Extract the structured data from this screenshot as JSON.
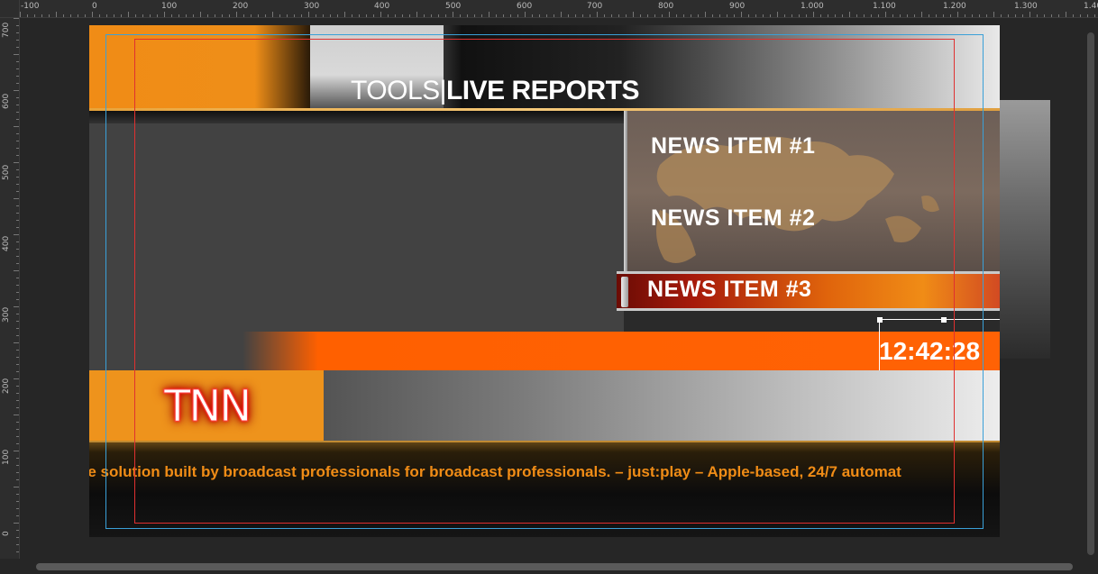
{
  "ruler": {
    "top_labels": [
      "-100",
      "0",
      "100",
      "200",
      "300",
      "400",
      "500",
      "600",
      "700",
      "800",
      "900",
      "1.000",
      "1.100",
      "1.200",
      "1.300",
      "1.40"
    ],
    "left_labels": [
      "700",
      "600",
      "500",
      "400",
      "300",
      "200",
      "100",
      "0"
    ]
  },
  "stage": {
    "header": {
      "title_left": "TOOLS|",
      "title_right": "LIVE REPORTS"
    },
    "news": {
      "item1": "NEWS ITEM #1",
      "item2": "NEWS ITEM #2",
      "item3": "NEWS ITEM #3"
    },
    "clock": "12:42:28",
    "logo": "TNN",
    "ticker": "ge solution built by broadcast professionals for broadcast professionals.  –  just:play – Apple-based, 24/7 automat"
  },
  "colors": {
    "accent_orange": "#f08c16",
    "bar_orange": "#ff6000",
    "guide_blue": "#3aa0d8",
    "guide_red": "#e03030"
  }
}
